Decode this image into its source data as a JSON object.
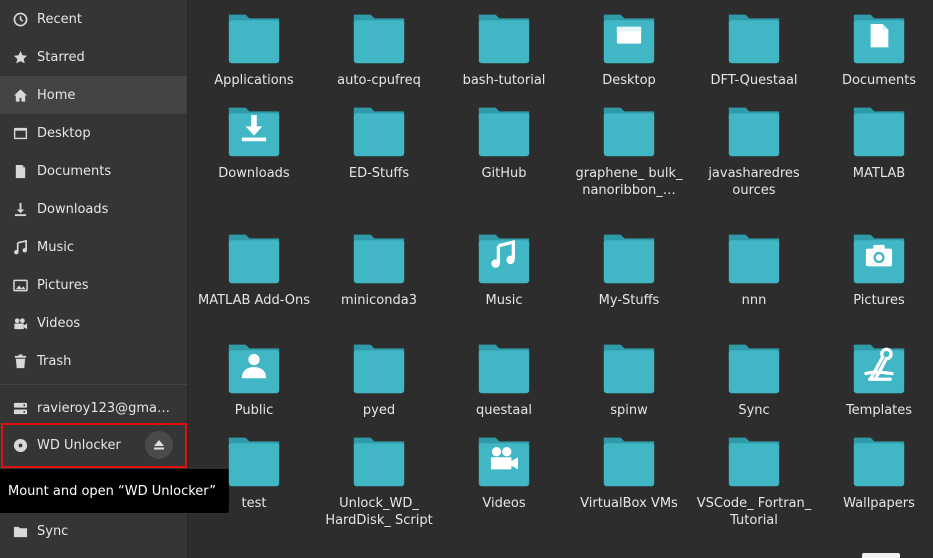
{
  "sidebar": {
    "items": [
      {
        "label": "Recent",
        "icon": "clock-icon"
      },
      {
        "label": "Starred",
        "icon": "star-icon"
      },
      {
        "label": "Home",
        "icon": "home-icon"
      },
      {
        "label": "Desktop",
        "icon": "desktop-icon"
      },
      {
        "label": "Documents",
        "icon": "document-icon"
      },
      {
        "label": "Downloads",
        "icon": "download-icon"
      },
      {
        "label": "Music",
        "icon": "music-icon"
      },
      {
        "label": "Pictures",
        "icon": "picture-icon"
      },
      {
        "label": "Videos",
        "icon": "video-icon"
      },
      {
        "label": "Trash",
        "icon": "trash-icon"
      }
    ],
    "network_account": "ravieroy123@gma…",
    "device": "WD Unlocker",
    "bottom_item": "Sync"
  },
  "tooltip": {
    "text": "Mount and open “WD Unlocker”"
  },
  "colors": {
    "folder": "#41b6c4",
    "folder_tab": "#2f9aa8",
    "sidebar_bg": "#353535",
    "content_bg": "#2d2d2d",
    "highlight": "#e01010"
  },
  "files": [
    {
      "name": "Applications",
      "emblem": ""
    },
    {
      "name": "auto-cpufreq",
      "emblem": ""
    },
    {
      "name": "bash-tutorial",
      "emblem": ""
    },
    {
      "name": "Desktop",
      "emblem": "desktop-icon"
    },
    {
      "name": "DFT-Questaal",
      "emblem": ""
    },
    {
      "name": "Documents",
      "emblem": "document-icon"
    },
    {
      "name": "Downloads",
      "emblem": "download-icon"
    },
    {
      "name": "ED-Stuffs",
      "emblem": ""
    },
    {
      "name": "GitHub",
      "emblem": ""
    },
    {
      "name": "graphene_ bulk_ nanoribbon_…",
      "emblem": ""
    },
    {
      "name": "javasharedres ources",
      "emblem": ""
    },
    {
      "name": "MATLAB",
      "emblem": ""
    },
    {
      "name": "MATLAB Add-Ons",
      "emblem": ""
    },
    {
      "name": "miniconda3",
      "emblem": ""
    },
    {
      "name": "Music",
      "emblem": "music-icon"
    },
    {
      "name": "My-Stuffs",
      "emblem": ""
    },
    {
      "name": "nnn",
      "emblem": ""
    },
    {
      "name": "Pictures",
      "emblem": "camera-icon"
    },
    {
      "name": "Public",
      "emblem": "person-icon"
    },
    {
      "name": "pyed",
      "emblem": ""
    },
    {
      "name": "questaal",
      "emblem": ""
    },
    {
      "name": "spinw",
      "emblem": ""
    },
    {
      "name": "Sync",
      "emblem": ""
    },
    {
      "name": "Templates",
      "emblem": "template-icon"
    },
    {
      "name": "test",
      "emblem": ""
    },
    {
      "name": "Unlock_WD_ HardDisk_ Script",
      "emblem": ""
    },
    {
      "name": "Videos",
      "emblem": "video-camera-icon"
    },
    {
      "name": "VirtualBox VMs",
      "emblem": ""
    },
    {
      "name": "VSCode_ Fortran_ Tutorial",
      "emblem": ""
    },
    {
      "name": "Wallpapers",
      "emblem": ""
    }
  ]
}
